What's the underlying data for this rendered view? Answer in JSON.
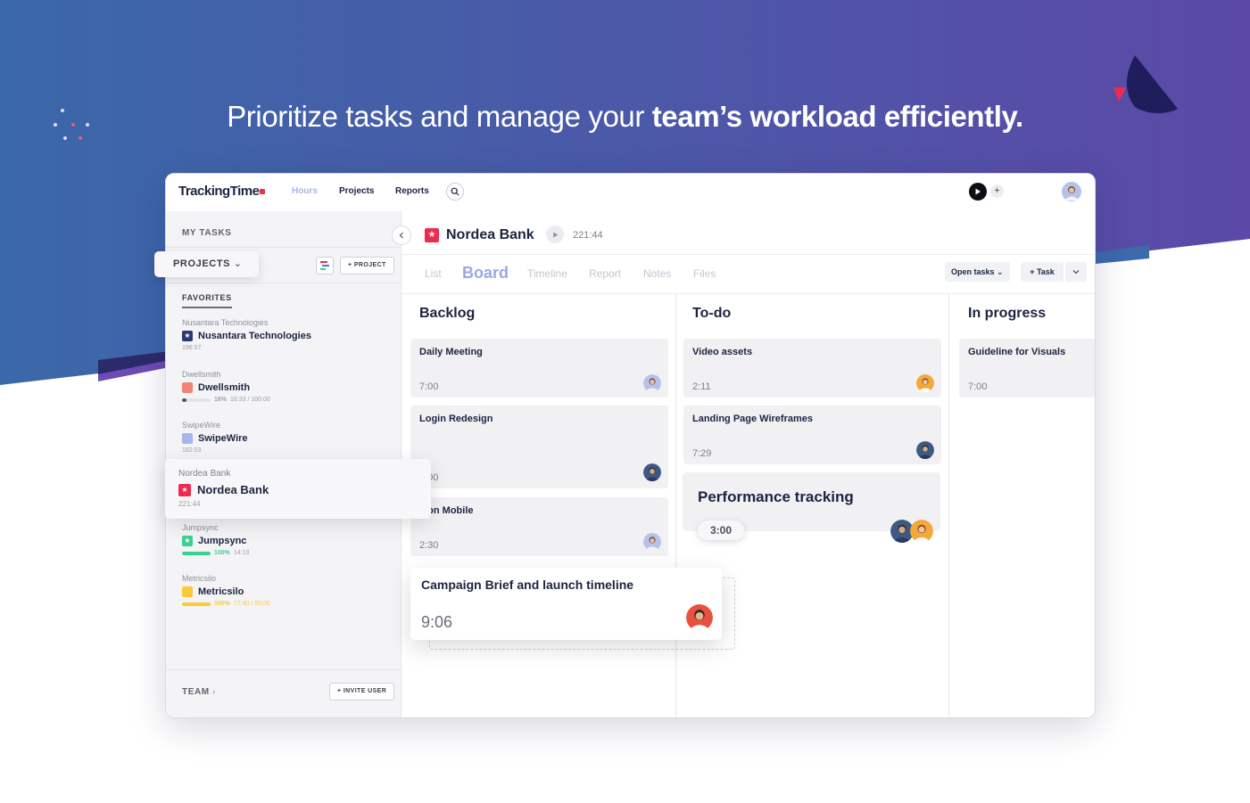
{
  "hero": {
    "headline_regular": "Prioritize tasks and manage your ",
    "headline_bold": "team’s workload efficiently.",
    "gradient_start": "#3a66a9",
    "gradient_end": "#5a48a6"
  },
  "topbar": {
    "brand": "TrackingTime",
    "nav_hours": "Hours",
    "nav_projects": "Projects",
    "nav_reports": "Reports",
    "plus_label": "+"
  },
  "sidebar": {
    "my_tasks": "MY TASKS",
    "projects_label": "PROJECTS",
    "add_project": "+ PROJECT",
    "favorites": "FAVORITES",
    "team": "TEAM",
    "invite_user": "+ INVITE USER",
    "projects": [
      {
        "client": "Nusantara Technologies",
        "name": "Nusantara Technologies",
        "meta": "196:57",
        "color": "#2a3a70",
        "icon": "star"
      },
      {
        "client": "Dwellsmith",
        "name": "Dwellsmith",
        "meta_pct": "16%",
        "meta": "16:33 / 100:00",
        "progress": 0.16,
        "color": "#f08476",
        "bar_color": "#56575f"
      },
      {
        "client": "SwipeWire",
        "name": "SwipeWire",
        "meta": "182:03",
        "color": "#a9b4ef"
      },
      {
        "client": "Jumpsync",
        "name": "Jumpsync",
        "meta_pct": "100%",
        "meta": "14:10",
        "progress": 1.0,
        "color": "#3dcf92",
        "bar_color": "#3dcf92",
        "icon": "star"
      },
      {
        "client": "Metricsilo",
        "name": "Metricsilo",
        "meta_pct": "100%",
        "meta": "77:40 / 50:00",
        "progress": 1.0,
        "color": "#fbc93a",
        "bar_color": "#fbc93a"
      }
    ],
    "dragged_project": {
      "client": "Nordea Bank",
      "name": "Nordea Bank",
      "meta": "221:44",
      "color": "#ef2a4e"
    }
  },
  "main": {
    "title": "Nordea Bank",
    "title_time": "221:44",
    "title_color": "#ef2a4e",
    "tabs": [
      "List",
      "Board",
      "Timeline",
      "Report",
      "Notes",
      "Files"
    ],
    "active_tab": "Board",
    "open_tasks": "Open tasks",
    "add_task": "+ Task"
  },
  "board": {
    "columns": [
      {
        "title": "Backlog",
        "cards": [
          {
            "title": "Daily Meeting",
            "duration": "7:00"
          },
          {
            "title": "Login Redesign",
            "duration": "7:00"
          },
          {
            "title": "Icon Mobile",
            "duration": "2:30"
          }
        ]
      },
      {
        "title": "To-do",
        "cards": [
          {
            "title": "Video assets",
            "duration": "2:11"
          },
          {
            "title": "Landing Page Wireframes",
            "duration": "7:29"
          },
          {
            "title": "Performance tracking",
            "duration": "3:00"
          }
        ]
      },
      {
        "title": "In progress",
        "cards": [
          {
            "title": "Guideline for Visuals",
            "duration": "7:00"
          }
        ]
      }
    ],
    "dragged_card": {
      "title": "Campaign Brief and launch timeline",
      "duration": "9:06"
    }
  }
}
